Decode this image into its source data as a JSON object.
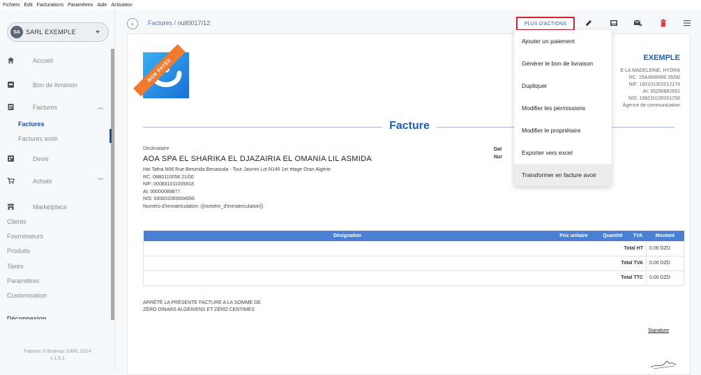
{
  "menubar": [
    "Fichiers",
    "Edit",
    "Facturations",
    "Paramètres",
    "Aide",
    "Activation"
  ],
  "sidebar": {
    "company": {
      "initials": "SA",
      "name": "SARL EXEMPLE"
    },
    "nav": {
      "accueil": "Accueil",
      "bon_livraison": "Bon de livraison",
      "factures": "Factures",
      "factures_sub": "Factures",
      "factures_avoir": "Factures avoir",
      "devis": "Devis",
      "achats": "Achats",
      "marketplace": "Marketplace",
      "clients": "Clients",
      "fournisseurs": "Fournisseurs",
      "produits": "Produits",
      "taxes": "Taxes",
      "parametres": "Paramètres",
      "customisation": "Customisation",
      "deconnexion": "Déconnexion"
    },
    "footer": {
      "line1": "Fatoura © Brainiac SARL 2024",
      "line2": "v 1.6.1"
    }
  },
  "header": {
    "breadcrumb_link": "Factures",
    "breadcrumb_sep": " / ",
    "breadcrumb_current": "null0017/12",
    "actions_label": "PLUS D'ACTIONS"
  },
  "dropdown": [
    "Ajouter un paiement",
    "Générer le bon de livraison",
    "Dupliquer",
    "Modifier les permissions",
    "Modifier le propriétaire",
    "Exporter vers excel",
    "Transformer en facture avoir"
  ],
  "invoice": {
    "ribbon": "NON PAYÉE",
    "company_title": "EXEMPLE",
    "company_info": [
      "E LA MADELEINE, HYDRA",
      "RC: 15A3668490 35/00",
      "NIF: 182101302012174",
      "AI: 35290882691",
      "NIS: 198210130201256",
      "Agence de communication"
    ],
    "title": "Facture",
    "dest_label": "Destinataire",
    "client_name": "AOA SPA EL SHARIKA EL DJAZAIRIA EL OMANIA LIL ASMIDA",
    "client_lines": [
      "Hai Tafna N06 Rue Benzrida Benaouda - Tour Jasmin Lot N146 1er étage Oran Algérie",
      "RC: 08B0110058 21/00",
      "NIF: 000831011005818",
      "AI: 00000089877",
      "NIS: 000831069004056",
      "Numéro d'immatriculation :{{numéro_d'immatriculation}}"
    ],
    "date_label": "Dat",
    "num_label": "Nur",
    "table": {
      "headers": [
        "Désignation",
        "Prix unitaire",
        "Quantité",
        "TVA",
        "Montant"
      ],
      "totals": [
        {
          "label": "Total HT",
          "value": "0.00 DZD"
        },
        {
          "label": "Total TVA",
          "value": "0.00 DZD"
        },
        {
          "label": "Total TTC",
          "value": "0.00 DZD"
        }
      ]
    },
    "arrete_line1": "ARRÊTÉ LA PRÉSENTE FACTURE A LA SOMME DE",
    "arrete_line2": "ZÉRO DINARS ALGÉRIENS ET ZÉRO CENTIMES",
    "signature": "Signature"
  },
  "colors": {
    "accent": "#1a5fb4",
    "danger": "#d21f2b",
    "ribbon": "#f07a2d"
  },
  "icons": [
    "home-icon",
    "delivery-icon",
    "invoice-icon",
    "quote-icon",
    "cart-icon",
    "store-icon",
    "edit-icon",
    "image-icon",
    "email-icon",
    "trash-icon",
    "menu-icon"
  ]
}
